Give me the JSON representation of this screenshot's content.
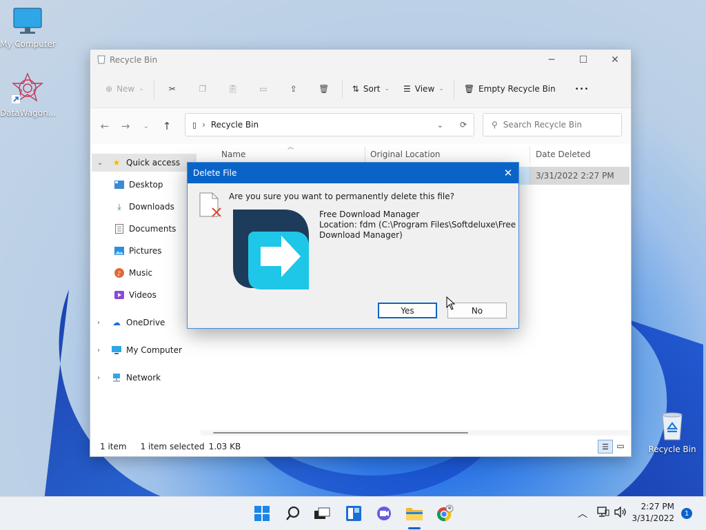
{
  "desktop": {
    "icons": [
      {
        "label": "My Computer",
        "icon": "monitor-icon"
      },
      {
        "label": "DataWagon...",
        "icon": "app-shortcut-icon"
      },
      {
        "label": "Recycle Bin",
        "icon": "recycle-bin-icon"
      }
    ]
  },
  "explorer": {
    "title": "Recycle Bin",
    "toolbar": {
      "new_label": "New",
      "sort_label": "Sort",
      "view_label": "View",
      "empty_label": "Empty Recycle Bin",
      "more_label": "•••"
    },
    "address": {
      "path": "Recycle Bin"
    },
    "search": {
      "placeholder": "Search Recycle Bin"
    },
    "nav": {
      "quick_access": "Quick access",
      "items": [
        "Desktop",
        "Downloads",
        "Documents",
        "Pictures",
        "Music",
        "Videos"
      ],
      "onedrive": "OneDrive",
      "my_computer": "My Computer",
      "network": "Network"
    },
    "columns": {
      "name": "Name",
      "original_location": "Original Location",
      "date_deleted": "Date Deleted"
    },
    "row": {
      "date_deleted": "3/31/2022 2:27 PM"
    },
    "status": {
      "count": "1 item",
      "selected": "1 item selected",
      "size": "1.03 KB"
    }
  },
  "dialog": {
    "title": "Delete File",
    "question": "Are you sure you want to permanently delete this file?",
    "file_name": "Free Download Manager",
    "location_line1": "Location: fdm (C:\\Program Files\\Softdeluxe\\Free",
    "location_line2": "Download Manager)",
    "yes_label": "Yes",
    "no_label": "No"
  },
  "taskbar": {
    "time": "2:27 PM",
    "date": "3/31/2022",
    "notification_count": "1"
  },
  "colors": {
    "accent": "#0a64c8",
    "fdm_dark": "#1d3b5a",
    "fdm_cyan": "#1ec6e8"
  }
}
